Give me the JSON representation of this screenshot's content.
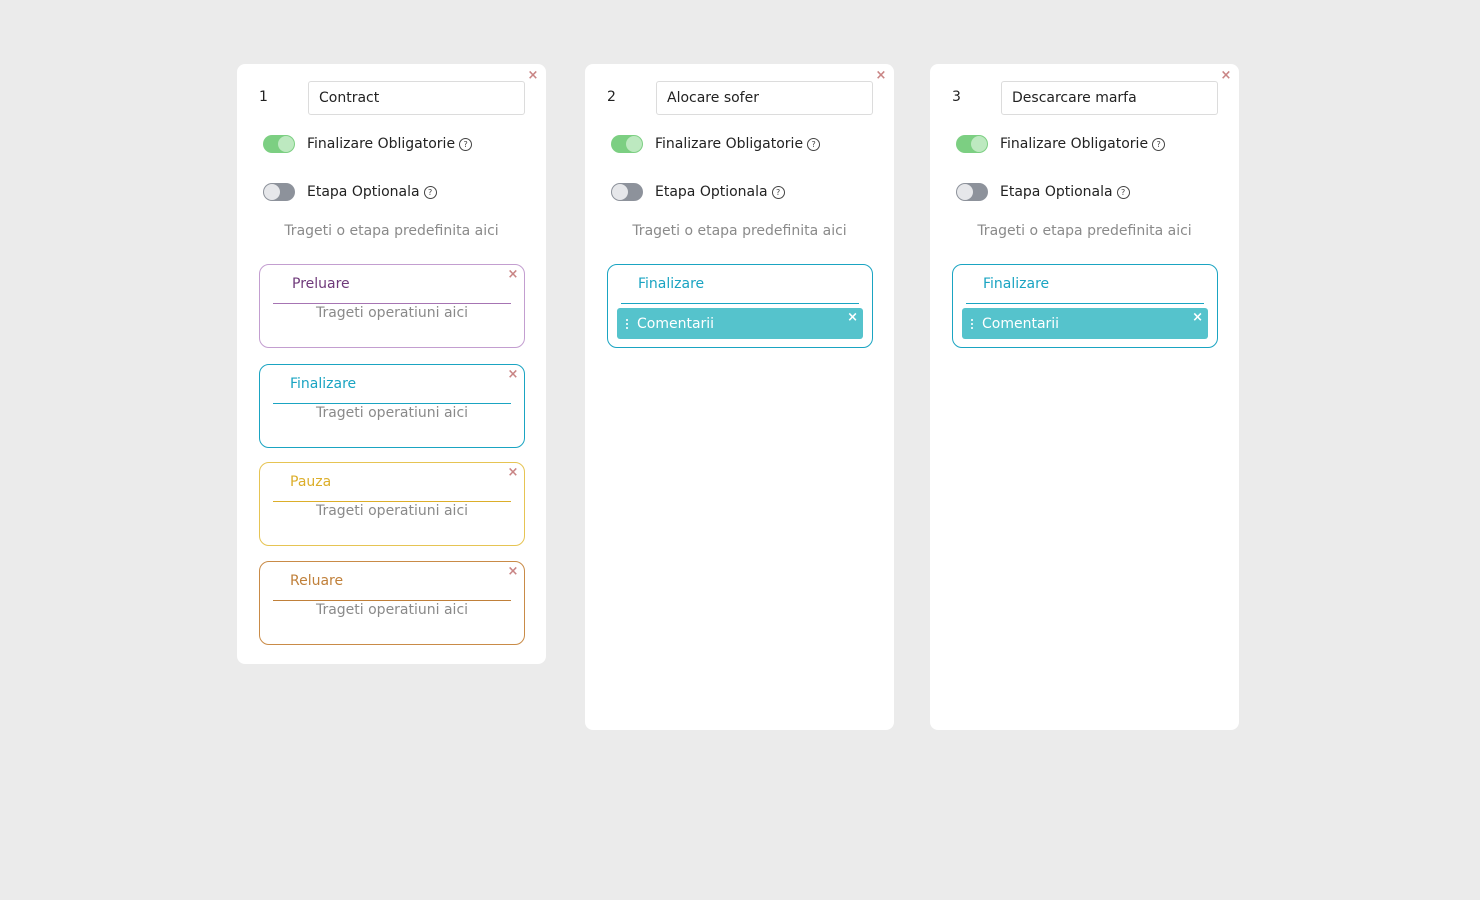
{
  "colors": {
    "preluare": "#6f3a7a",
    "preluare_border": "#c39ed0",
    "finalizare": "#1aa4c2",
    "pauza": "#dcae2a",
    "reluare": "#c0803a",
    "op_background": "#55c3cc",
    "toggle_on": "#7ccf82",
    "toggle_off": "#8d929b"
  },
  "labels": {
    "mandatory": "Finalizare Obligatorie",
    "optional": "Etapa Optionala",
    "drop_stage_hint": "Trageti o etapa predefinita aici",
    "drop_op_hint": "Trageti operatiuni aici",
    "close": "×",
    "help": "?"
  },
  "stages": [
    {
      "number": "1",
      "name": "Contract",
      "mandatory_on": true,
      "optional_on": false,
      "phases": [
        {
          "title": "Preluare"
        },
        {
          "title": "Finalizare"
        },
        {
          "title": "Pauza"
        },
        {
          "title": "Reluare"
        }
      ]
    },
    {
      "number": "2",
      "name": "Alocare sofer",
      "mandatory_on": true,
      "optional_on": false,
      "phases": [
        {
          "title": "Finalizare",
          "operation": "Comentarii"
        }
      ]
    },
    {
      "number": "3",
      "name": "Descarcare marfa",
      "mandatory_on": true,
      "optional_on": false,
      "phases": [
        {
          "title": "Finalizare",
          "operation": "Comentarii"
        }
      ]
    }
  ]
}
